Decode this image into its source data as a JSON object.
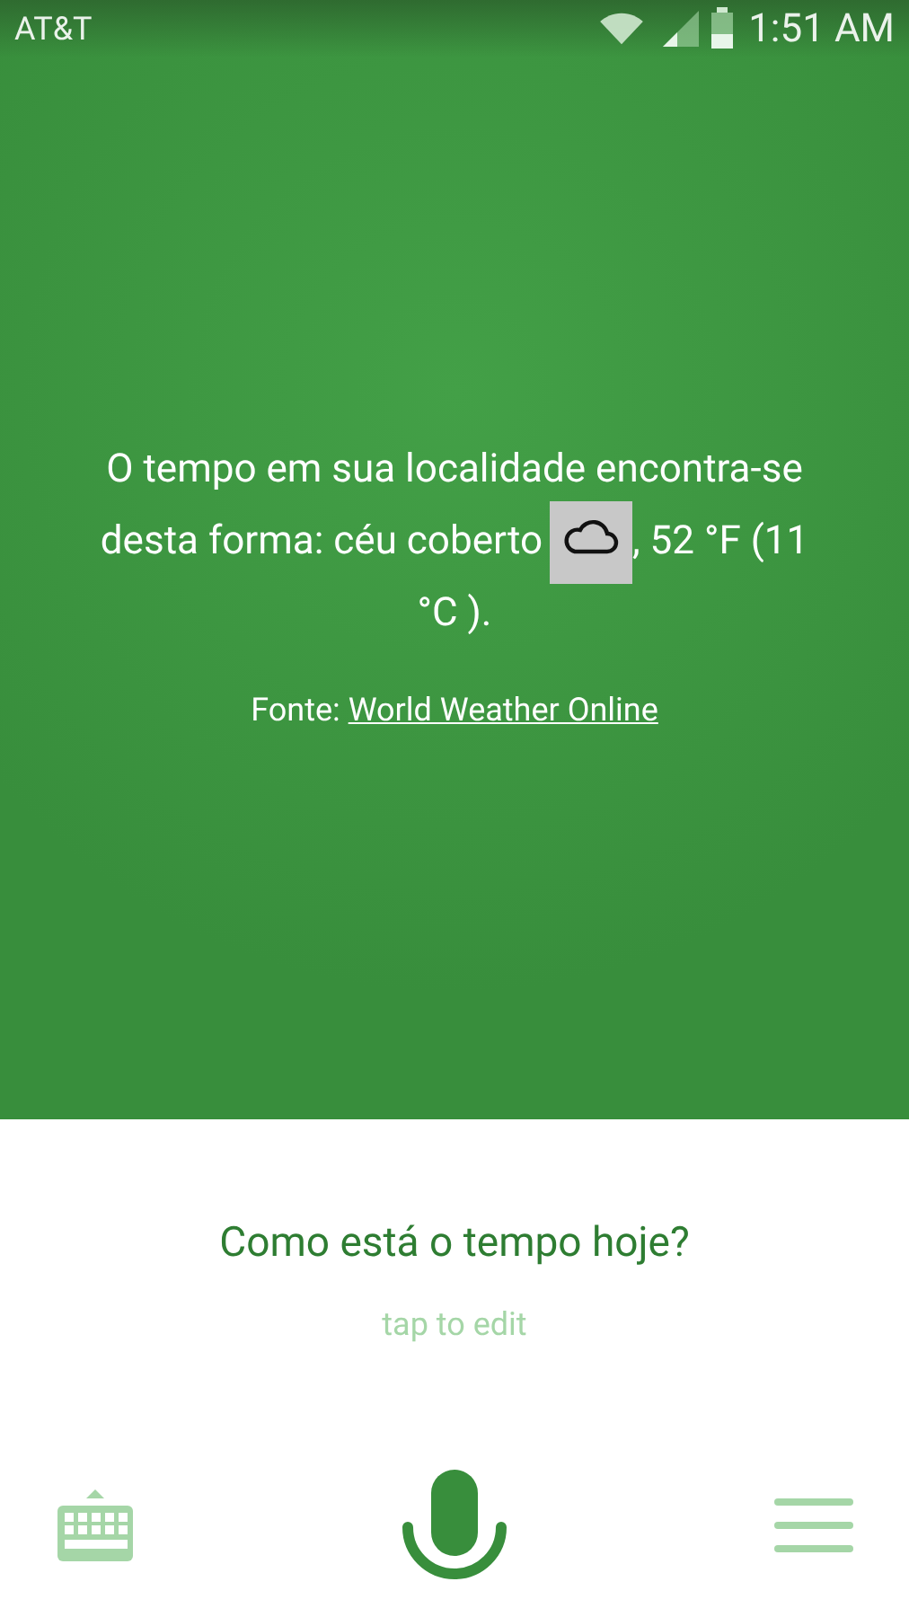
{
  "status_bar": {
    "carrier": "AT&T",
    "time": "1:51 AM"
  },
  "answer": {
    "lines": [
      {
        "text": "O tempo em sua localidade encontra-se"
      },
      {
        "text": "desta forma: céu coberto",
        "kind": "with_icon",
        "text_after": ", 52 °F (11"
      },
      {
        "text": "°C )."
      }
    ]
  },
  "source": {
    "label": "Fonte:",
    "link": "World Weather Online"
  },
  "query": {
    "text": "Como está o tempo hoje?",
    "hint": "tap to edit"
  }
}
